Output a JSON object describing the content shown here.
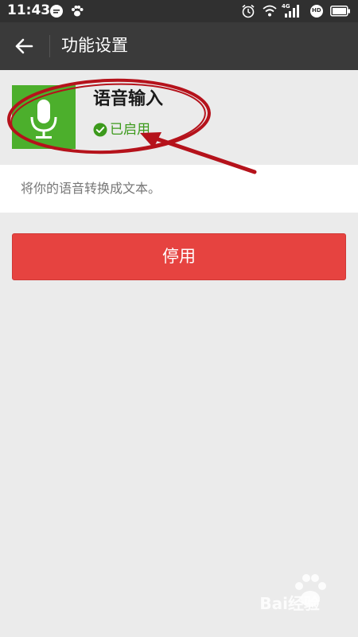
{
  "status_bar": {
    "time": "11:43",
    "network": "4G",
    "badge": "HD",
    "icons": [
      "message-icon",
      "paw-icon",
      "alarm-icon",
      "wifi-icon",
      "signal-icon",
      "hd-icon",
      "battery-icon"
    ]
  },
  "app_bar": {
    "back_icon": "back-arrow-icon",
    "title": "功能设置"
  },
  "feature": {
    "icon": "microphone-icon",
    "icon_bg": "#4caf2c",
    "name": "语音输入",
    "status_icon": "check-circle-icon",
    "status": "已启用",
    "status_color": "#3c9a1c"
  },
  "description": "将你的语音转换成文本。",
  "actions": {
    "disable_label": "停用",
    "disable_color": "#e64340"
  },
  "annotation": {
    "color": "#b5121b"
  },
  "watermark": {
    "text": "Bai经验"
  }
}
